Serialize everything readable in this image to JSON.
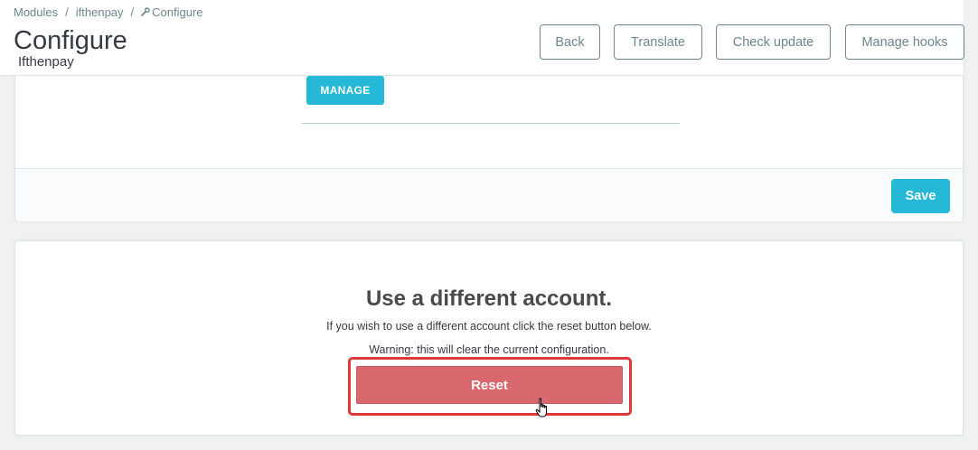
{
  "breadcrumb": {
    "items": [
      "Modules",
      "ifthenpay",
      "Configure"
    ],
    "separator": "/",
    "current_icon": "wrench-icon"
  },
  "header": {
    "title": "Configure",
    "subtitle": "Ifthenpay"
  },
  "toolbar": {
    "back_label": "Back",
    "translate_label": "Translate",
    "check_update_label": "Check update",
    "manage_hooks_label": "Manage hooks"
  },
  "config_panel": {
    "manage_label": "MANAGE",
    "save_label": "Save"
  },
  "reset_panel": {
    "title": "Use a different account.",
    "description": "If you wish to use a different account click the reset button below.",
    "warning": "Warning: this will clear the current configuration.",
    "reset_label": "Reset"
  },
  "colors": {
    "primary": "#25b9d7",
    "danger": "#d8686e",
    "highlight": "#e0383a"
  }
}
